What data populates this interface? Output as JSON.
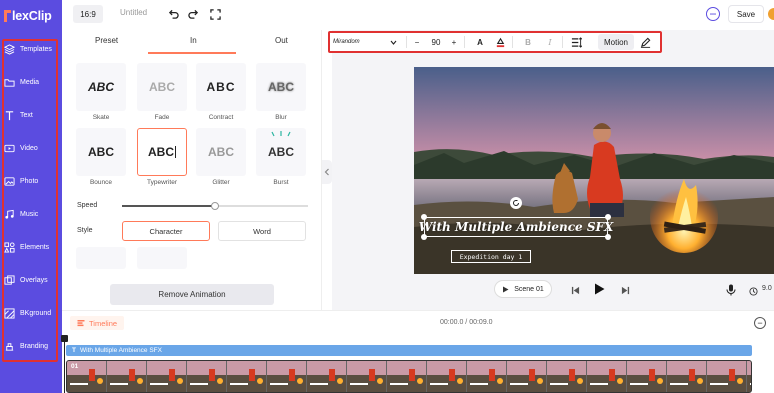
{
  "app": {
    "logo": "lexClip"
  },
  "topbar": {
    "ratio": "16:9",
    "title": "Untitled",
    "save_label": "Save"
  },
  "sidebar": {
    "items": [
      {
        "label": "Templates",
        "icon": "layers-icon"
      },
      {
        "label": "Media",
        "icon": "folder-icon"
      },
      {
        "label": "Text",
        "icon": "text-icon"
      },
      {
        "label": "Video",
        "icon": "video-icon"
      },
      {
        "label": "Photo",
        "icon": "photo-icon"
      },
      {
        "label": "Music",
        "icon": "music-icon"
      },
      {
        "label": "Elements",
        "icon": "elements-icon"
      },
      {
        "label": "Overlays",
        "icon": "overlays-icon"
      },
      {
        "label": "BKground",
        "icon": "background-icon"
      },
      {
        "label": "Branding",
        "icon": "branding-icon"
      }
    ]
  },
  "panel": {
    "tabs": [
      "Preset",
      "In",
      "Out"
    ],
    "active_tab": "In",
    "effects": [
      {
        "preview": "ABC",
        "label": "Skate"
      },
      {
        "preview": "ABC",
        "label": "Fade"
      },
      {
        "preview": "ABC",
        "label": "Contract"
      },
      {
        "preview": "ABC",
        "label": "Blur"
      },
      {
        "preview": "ABC",
        "label": "Bounce"
      },
      {
        "preview": "ABC",
        "label": "Typewriter",
        "selected": true
      },
      {
        "preview": "ABC",
        "label": "Glitter"
      },
      {
        "preview": "ABC",
        "label": "Burst"
      }
    ],
    "speed_label": "Speed",
    "speed_value": 0.5,
    "style_label": "Style",
    "style_options": [
      "Character",
      "Word"
    ],
    "style_selected": "Character",
    "remove_label": "Remove Animation"
  },
  "toolbar": {
    "font": "Mirandom",
    "font_size": "90",
    "motion_label": "Motion"
  },
  "canvas": {
    "title_text": "With Multiple Ambience SFX",
    "subtitle_text": "Expedition day 1"
  },
  "player": {
    "scene_label": "Scene 01",
    "time_partial": "9.0"
  },
  "timeline": {
    "label": "Timeline",
    "time_display": "00:00.0 / 00:09.0",
    "text_track_label": "With Multiple Ambience SFX",
    "clip_number": "01",
    "accent": "#ff7a59"
  },
  "colors": {
    "sidebar_bg": "#5b4ce0",
    "accent": "#ff7a59",
    "highlight_box": "#e03131",
    "text_track": "#6aa6e8"
  }
}
